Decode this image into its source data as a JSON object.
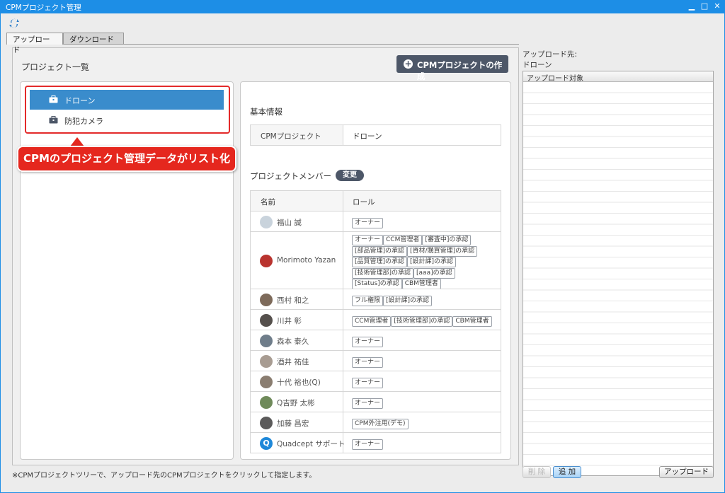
{
  "window": {
    "title": "CPMプロジェクト管理"
  },
  "tabs": [
    {
      "label": "アップロード",
      "active": true
    },
    {
      "label": "ダウンロード",
      "active": false
    }
  ],
  "left": {
    "heading": "プロジェクト一覧",
    "create_button": "CPMプロジェクトの作成",
    "projects": [
      {
        "label": "ドローン",
        "selected": true,
        "icon": "briefcase-icon"
      },
      {
        "label": "防犯カメラ",
        "selected": false,
        "icon": "briefcase-icon"
      }
    ],
    "callout": "CPMのプロジェクト管理データがリスト化"
  },
  "detail": {
    "basic_info_title": "基本情報",
    "project_key": "CPMプロジェクト",
    "project_value": "ドローン",
    "members_title": "プロジェクトメンバー",
    "change_button": "変更",
    "col_name": "名前",
    "col_role": "ロール",
    "members": [
      {
        "name": "福山 誠",
        "roles": [
          [
            "オーナー"
          ]
        ]
      },
      {
        "name": "Morimoto Yazan",
        "roles": [
          [
            "オーナー",
            "CCM管理者",
            "[審査中]の承認"
          ],
          [
            "[部品管理]の承認",
            "[資材/購買管理]の承認"
          ],
          [
            "[品質管理]の承認",
            "[設計課]の承認"
          ],
          [
            "[技術管理部]の承認",
            "[aaa]の承認"
          ],
          [
            "[Status]の承認",
            "CBM管理者"
          ]
        ]
      },
      {
        "name": "西村 和之",
        "roles": [
          [
            "フル権限",
            "[設計課]の承認"
          ]
        ]
      },
      {
        "name": "川井 彰",
        "roles": [
          [
            "CCM管理者",
            "[技術管理部]の承認",
            "CBM管理者"
          ]
        ]
      },
      {
        "name": "森本 泰久",
        "roles": [
          [
            "オーナー"
          ]
        ]
      },
      {
        "name": "酒井 祐佳",
        "roles": [
          [
            "オーナー"
          ]
        ]
      },
      {
        "name": "十代 裕也(Q)",
        "roles": [
          [
            "オーナー"
          ]
        ]
      },
      {
        "name": "Q吉野 太彬",
        "roles": [
          [
            "オーナー"
          ]
        ]
      },
      {
        "name": "加藤 昌宏",
        "roles": [
          [
            "CPM外注用(デモ)"
          ]
        ]
      },
      {
        "name": "Quadcept サポート",
        "roles": [
          [
            "オーナー"
          ]
        ]
      }
    ]
  },
  "right": {
    "dest_label": "アップロード先:",
    "dest_value": "ドローン",
    "list_header": "アップロード対象"
  },
  "buttons": {
    "delete": "削 除",
    "add": "追 加",
    "upload": "アップロード"
  },
  "footnote": "※CPMプロジェクトツリーで、アップロード先のCPMプロジェクトをクリックして指定します。",
  "colors": {
    "titlebar": "#1d8ee6",
    "selected": "#3a8ccc",
    "callout": "#e5271e",
    "dark_button": "#4d5768"
  }
}
